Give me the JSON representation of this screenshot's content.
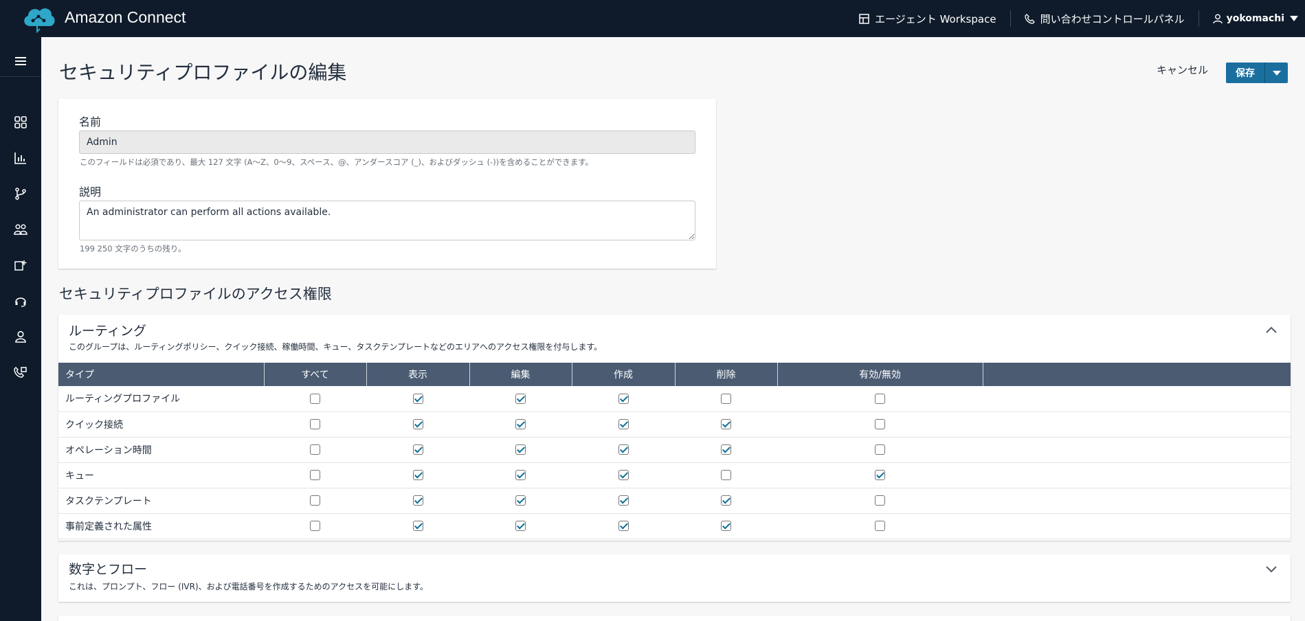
{
  "app": {
    "title": "Amazon Connect"
  },
  "topbar": {
    "agent_workspace": "エージェント Workspace",
    "ccp": "問い合わせコントロールパネル",
    "user": "yokomachi"
  },
  "sidebar": {
    "items": [
      {
        "icon": "dashboard-icon"
      },
      {
        "icon": "analytics-icon"
      },
      {
        "icon": "routing-icon"
      },
      {
        "icon": "users-icon"
      },
      {
        "icon": "channels-icon"
      },
      {
        "icon": "headset-icon"
      },
      {
        "icon": "profile-icon"
      },
      {
        "icon": "phone-icon"
      }
    ]
  },
  "page": {
    "title": "セキュリティプロファイルの編集",
    "cancel": "キャンセル",
    "save": "保存"
  },
  "form": {
    "name_label": "名前",
    "name_value": "Admin",
    "name_hint": "このフィールドは必須であり、最大 127 文字 (A〜Z、0〜9、スペース、@、アンダースコア (_)、およびダッシュ (-))を含めることができます。",
    "desc_label": "説明",
    "desc_value": "An administrator can perform all actions available.",
    "desc_hint": "199 250 文字のうちの残り。"
  },
  "permissions": {
    "title": "セキュリティプロファイルのアクセス権限",
    "routing": {
      "title": "ルーティング",
      "desc": "このグループは、ルーティングポリシー、クイック接続、稼働時間、キュー、タスクテンプレートなどのエリアへのアクセス権限を付与します。",
      "headers": [
        "タイプ",
        "すべて",
        "表示",
        "編集",
        "作成",
        "削除",
        "有効/無効",
        ""
      ],
      "rows": [
        {
          "type": "ルーティングプロファイル",
          "checks": [
            false,
            true,
            true,
            true,
            false,
            false
          ]
        },
        {
          "type": "クイック接続",
          "checks": [
            false,
            true,
            true,
            true,
            true,
            false
          ]
        },
        {
          "type": "オペレーション時間",
          "checks": [
            false,
            true,
            true,
            true,
            true,
            false
          ]
        },
        {
          "type": "キュー",
          "checks": [
            false,
            true,
            true,
            true,
            false,
            true
          ]
        },
        {
          "type": "タスクテンプレート",
          "checks": [
            false,
            true,
            true,
            true,
            true,
            false
          ]
        },
        {
          "type": "事前定義された属性",
          "checks": [
            false,
            true,
            true,
            true,
            true,
            false
          ]
        }
      ]
    },
    "numbers_flows": {
      "title": "数字とフロー",
      "desc": "これは、プロンプト、フロー (IVR)、および電話番号を作成するためのアクセスを可能にします。"
    }
  },
  "colors": {
    "topbar": "#0f1b2a",
    "accent": "#1a6f9f",
    "table_header": "#4a5b72"
  }
}
